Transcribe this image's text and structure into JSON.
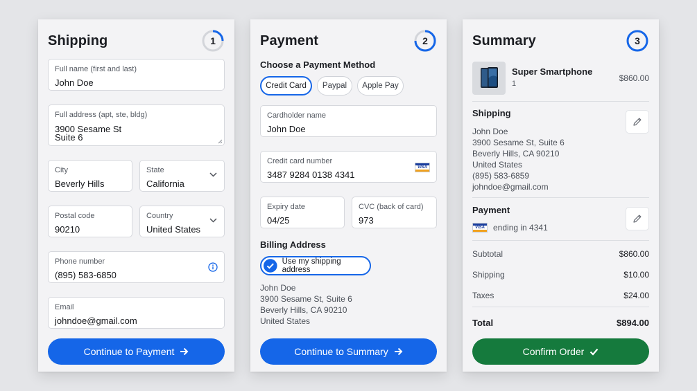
{
  "shipping": {
    "title": "Shipping",
    "step": "1",
    "fullname": {
      "label": "Full name (first and last)",
      "value": "John Doe"
    },
    "address": {
      "label": "Full address (apt, ste, bldg)",
      "line1": "3900 Sesame St",
      "line2": "Suite 6"
    },
    "city": {
      "label": "City",
      "value": "Beverly Hills"
    },
    "state": {
      "label": "State",
      "value": "California"
    },
    "postal": {
      "label": "Postal code",
      "value": "90210"
    },
    "country": {
      "label": "Country",
      "value": "United States"
    },
    "phone": {
      "label": "Phone number",
      "value": "(895) 583-6850"
    },
    "email": {
      "label": "Email",
      "value": "johndoe@gmail.com"
    },
    "button": "Continue to Payment"
  },
  "payment": {
    "title": "Payment",
    "step": "2",
    "method_heading": "Choose a Payment Method",
    "methods": [
      "Credit Card",
      "Paypal",
      "Apple Pay"
    ],
    "cardholder": {
      "label": "Cardholder name",
      "value": "John Doe"
    },
    "cardnumber": {
      "label": "Credit card number",
      "value": "3487 9284 0138 4341"
    },
    "expiry": {
      "label": "Expiry date",
      "value": "04/25"
    },
    "cvc": {
      "label": "CVC (back of card)",
      "value": "973"
    },
    "billing_heading": "Billing Address",
    "use_shipping": "Use my shipping address",
    "billing_lines": [
      "John Doe",
      "3900 Sesame St, Suite 6",
      "Beverly Hills, CA 90210",
      "United States"
    ],
    "button": "Continue to Summary"
  },
  "summary": {
    "title": "Summary",
    "step": "3",
    "product": {
      "name": "Super Smartphone",
      "qty": "1",
      "price": "$860.00"
    },
    "shipping_heading": "Shipping",
    "shipping_lines": [
      "John Doe",
      "3900 Sesame St, Suite 6",
      "Beverly Hills, CA 90210",
      "United States",
      "(895) 583-6859",
      "johndoe@gmail.com"
    ],
    "payment_heading": "Payment",
    "payment_text": "ending in 4341",
    "card_brand": "VISA",
    "subtotal": {
      "label": "Subtotal",
      "value": "$860.00"
    },
    "shipping_cost": {
      "label": "Shipping",
      "value": "$10.00"
    },
    "taxes": {
      "label": "Taxes",
      "value": "$24.00"
    },
    "total": {
      "label": "Total",
      "value": "$894.00"
    },
    "button": "Confirm Order"
  },
  "colors": {
    "accent": "#1566e8",
    "confirm": "#157a3d",
    "background": "#e4e5e8",
    "panel": "#f3f3f5"
  },
  "icons": {
    "step_ring": "progress-ring",
    "next": "arrow-right-icon",
    "confirm": "checkmark-icon",
    "edit": "pencil-icon",
    "info": "info-icon",
    "select": "chevron-down-icon",
    "card": "visa-card-icon",
    "checkbox": "check-circle-icon"
  }
}
